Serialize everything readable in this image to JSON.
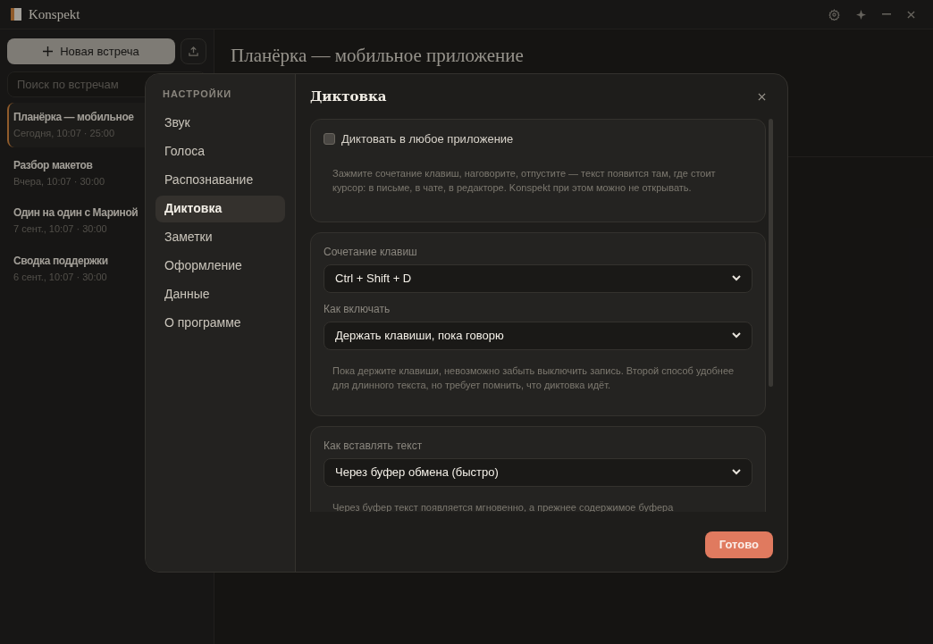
{
  "window": {
    "title": "Konspekt"
  },
  "sidebar": {
    "new_button": "Новая встреча",
    "search": {
      "placeholder": "Поиск по встречам"
    },
    "meetings": [
      {
        "title": "Планёрка — мобильное",
        "time": "Сегодня, 10:07 · 25:00",
        "selected": true
      },
      {
        "title": "Разбор макетов",
        "time": "Вчера, 10:07 · 30:00",
        "selected": false
      },
      {
        "title": "Один на один с Мариной",
        "time": "7 сент., 10:07 · 30:00",
        "selected": false
      },
      {
        "title": "Сводка поддержки",
        "time": "6 сент., 10:07 · 30:00",
        "selected": false
      }
    ]
  },
  "main": {
    "title": "Планёрка — мобильное приложение"
  },
  "settings": {
    "heading": "НАСТРОЙКИ",
    "nav": [
      {
        "label": "Звук",
        "selected": false
      },
      {
        "label": "Голоса",
        "selected": false
      },
      {
        "label": "Распознавание",
        "selected": false
      },
      {
        "label": "Диктовка",
        "selected": true
      },
      {
        "label": "Заметки",
        "selected": false
      },
      {
        "label": "Оформление",
        "selected": false
      },
      {
        "label": "Данные",
        "selected": false
      },
      {
        "label": "О программе",
        "selected": false
      }
    ],
    "title": "Диктовка",
    "cards": [
      {
        "kind": "checkbox",
        "label": "Диктовать в любое приложение",
        "checked": false,
        "hint": "Зажмите сочетание клавиш, наговорите, отпустите — текст появится там, где стоит курсор: в письме, в чате, в редакторе. Konspekt при этом можно не открывать."
      },
      {
        "kind": "selects",
        "fields": [
          {
            "label": "Сочетание клавиш",
            "value": "Ctrl + Shift + D"
          },
          {
            "label": "Как включать",
            "value": "Держать клавиши, пока говорю"
          }
        ],
        "hint": "Пока держите клавиши, невозможно забыть выключить запись. Второй способ удобнее для длинного текста, но требует помнить, что диктовка идёт."
      },
      {
        "kind": "selects",
        "fields": [
          {
            "label": "Как вставлять текст",
            "value": "Через буфер обмена (быстро)"
          }
        ],
        "hint": "Через буфер текст появляется мгновенно, а прежнее содержимое буфера"
      }
    ],
    "done_button": "Готово"
  }
}
